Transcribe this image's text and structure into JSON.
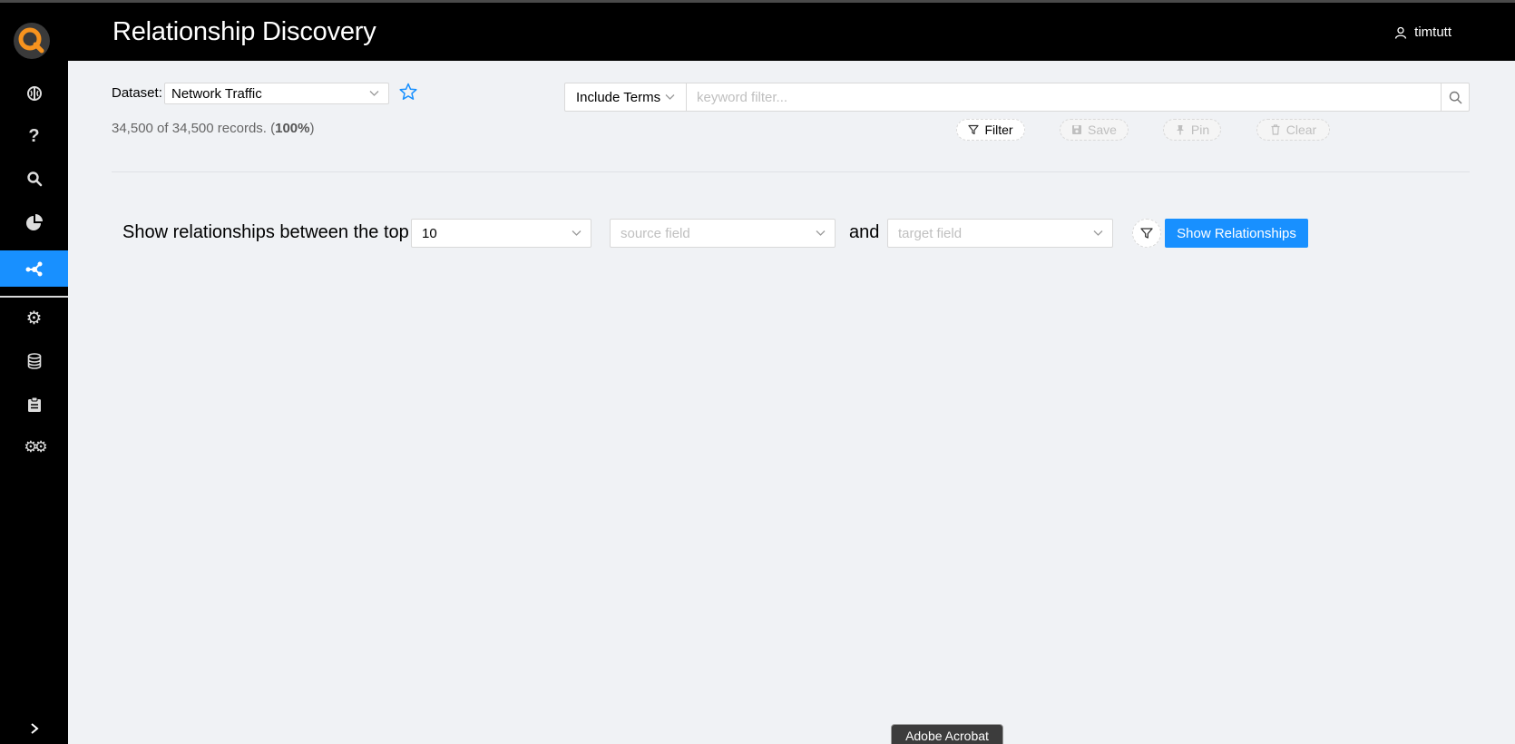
{
  "header": {
    "title": "Relationship Discovery",
    "username": "timtutt"
  },
  "sidebar": {
    "items": [
      {
        "icon": "brain-icon"
      },
      {
        "icon": "question-icon"
      },
      {
        "icon": "search-icon"
      },
      {
        "icon": "pie-chart-icon"
      },
      {
        "icon": "network-icon",
        "active": true
      },
      {
        "icon": "gear-icon"
      },
      {
        "icon": "database-icon"
      },
      {
        "icon": "clipboard-icon"
      },
      {
        "icon": "gears-icon"
      }
    ],
    "expand_icon": "chevron-right-icon"
  },
  "dataset": {
    "label": "Dataset:",
    "value": "Network Traffic"
  },
  "records": {
    "prefix": "34,500 of 34,500 records. (",
    "percent": "100%",
    "suffix": ")"
  },
  "filter": {
    "mode": "Include Terms",
    "placeholder": "keyword filter...",
    "buttons": {
      "filter": "Filter",
      "save": "Save",
      "pin": "Pin",
      "clear": "Clear"
    }
  },
  "relationships": {
    "prefix": "Show relationships between the top",
    "top_value": "10",
    "source_placeholder": "source field",
    "and": "and",
    "target_placeholder": "target field",
    "button": "Show Relationships"
  },
  "tooltip": "Adobe Acrobat",
  "colors": {
    "accent": "#1890ff",
    "brand_orange": "#f7931e",
    "header": "#000000"
  }
}
